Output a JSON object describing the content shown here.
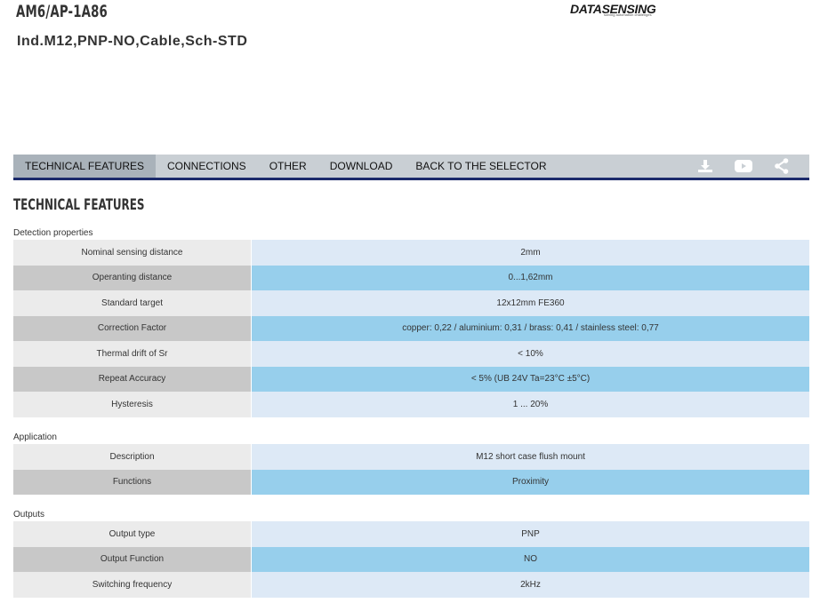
{
  "header": {
    "product_code": "AM6/AP-1A86",
    "product_description": "Ind.M12,PNP-NO,Cable,Sch-STD",
    "logo_text": "DATASENSING",
    "logo_tagline": "solving automation challenges"
  },
  "tabs": [
    {
      "label": "TECHNICAL FEATURES",
      "active": true
    },
    {
      "label": "CONNECTIONS",
      "active": false
    },
    {
      "label": "OTHER",
      "active": false
    },
    {
      "label": "DOWNLOAD",
      "active": false
    },
    {
      "label": "BACK TO THE SELECTOR",
      "active": false
    }
  ],
  "tab_icons": [
    "download-icon",
    "youtube-icon",
    "share-icon"
  ],
  "section_title": "TECHNICAL FEATURES",
  "groups": {
    "detection": {
      "label": "Detection properties",
      "rows": [
        {
          "label": "Nominal sensing distance",
          "value": "2mm"
        },
        {
          "label": "Operanting distance",
          "value": "0...1,62mm"
        },
        {
          "label": "Standard target",
          "value": "12x12mm FE360"
        },
        {
          "label": "Correction Factor",
          "value": "copper: 0,22 / aluminium: 0,31 / brass: 0,41 / stainless steel: 0,77"
        },
        {
          "label": "Thermal drift of Sr",
          "value": "< 10%"
        },
        {
          "label": "Repeat Accuracy",
          "value": "< 5% (UB 24V Ta=23°C ±5°C)"
        },
        {
          "label": "Hysteresis",
          "value": "1 ... 20%"
        }
      ]
    },
    "application": {
      "label": "Application",
      "rows": [
        {
          "label": "Description",
          "value": "M12 short case flush mount"
        },
        {
          "label": "Functions",
          "value": "Proximity"
        }
      ]
    },
    "outputs": {
      "label": "Outputs",
      "rows": [
        {
          "label": "Output type",
          "value": "PNP"
        },
        {
          "label": "Output Function",
          "value": "NO"
        },
        {
          "label": "Switching frequency",
          "value": "2kHz"
        }
      ]
    }
  },
  "colors": {
    "tab_bar": "#c9cfd4",
    "tab_active": "#a9b2ba",
    "tab_underline": "#1b2a6b",
    "row_label_light": "#ebebeb",
    "row_label_dark": "#c8c8c8",
    "row_value_light": "#dde9f6",
    "row_value_dark": "#97cfec"
  }
}
